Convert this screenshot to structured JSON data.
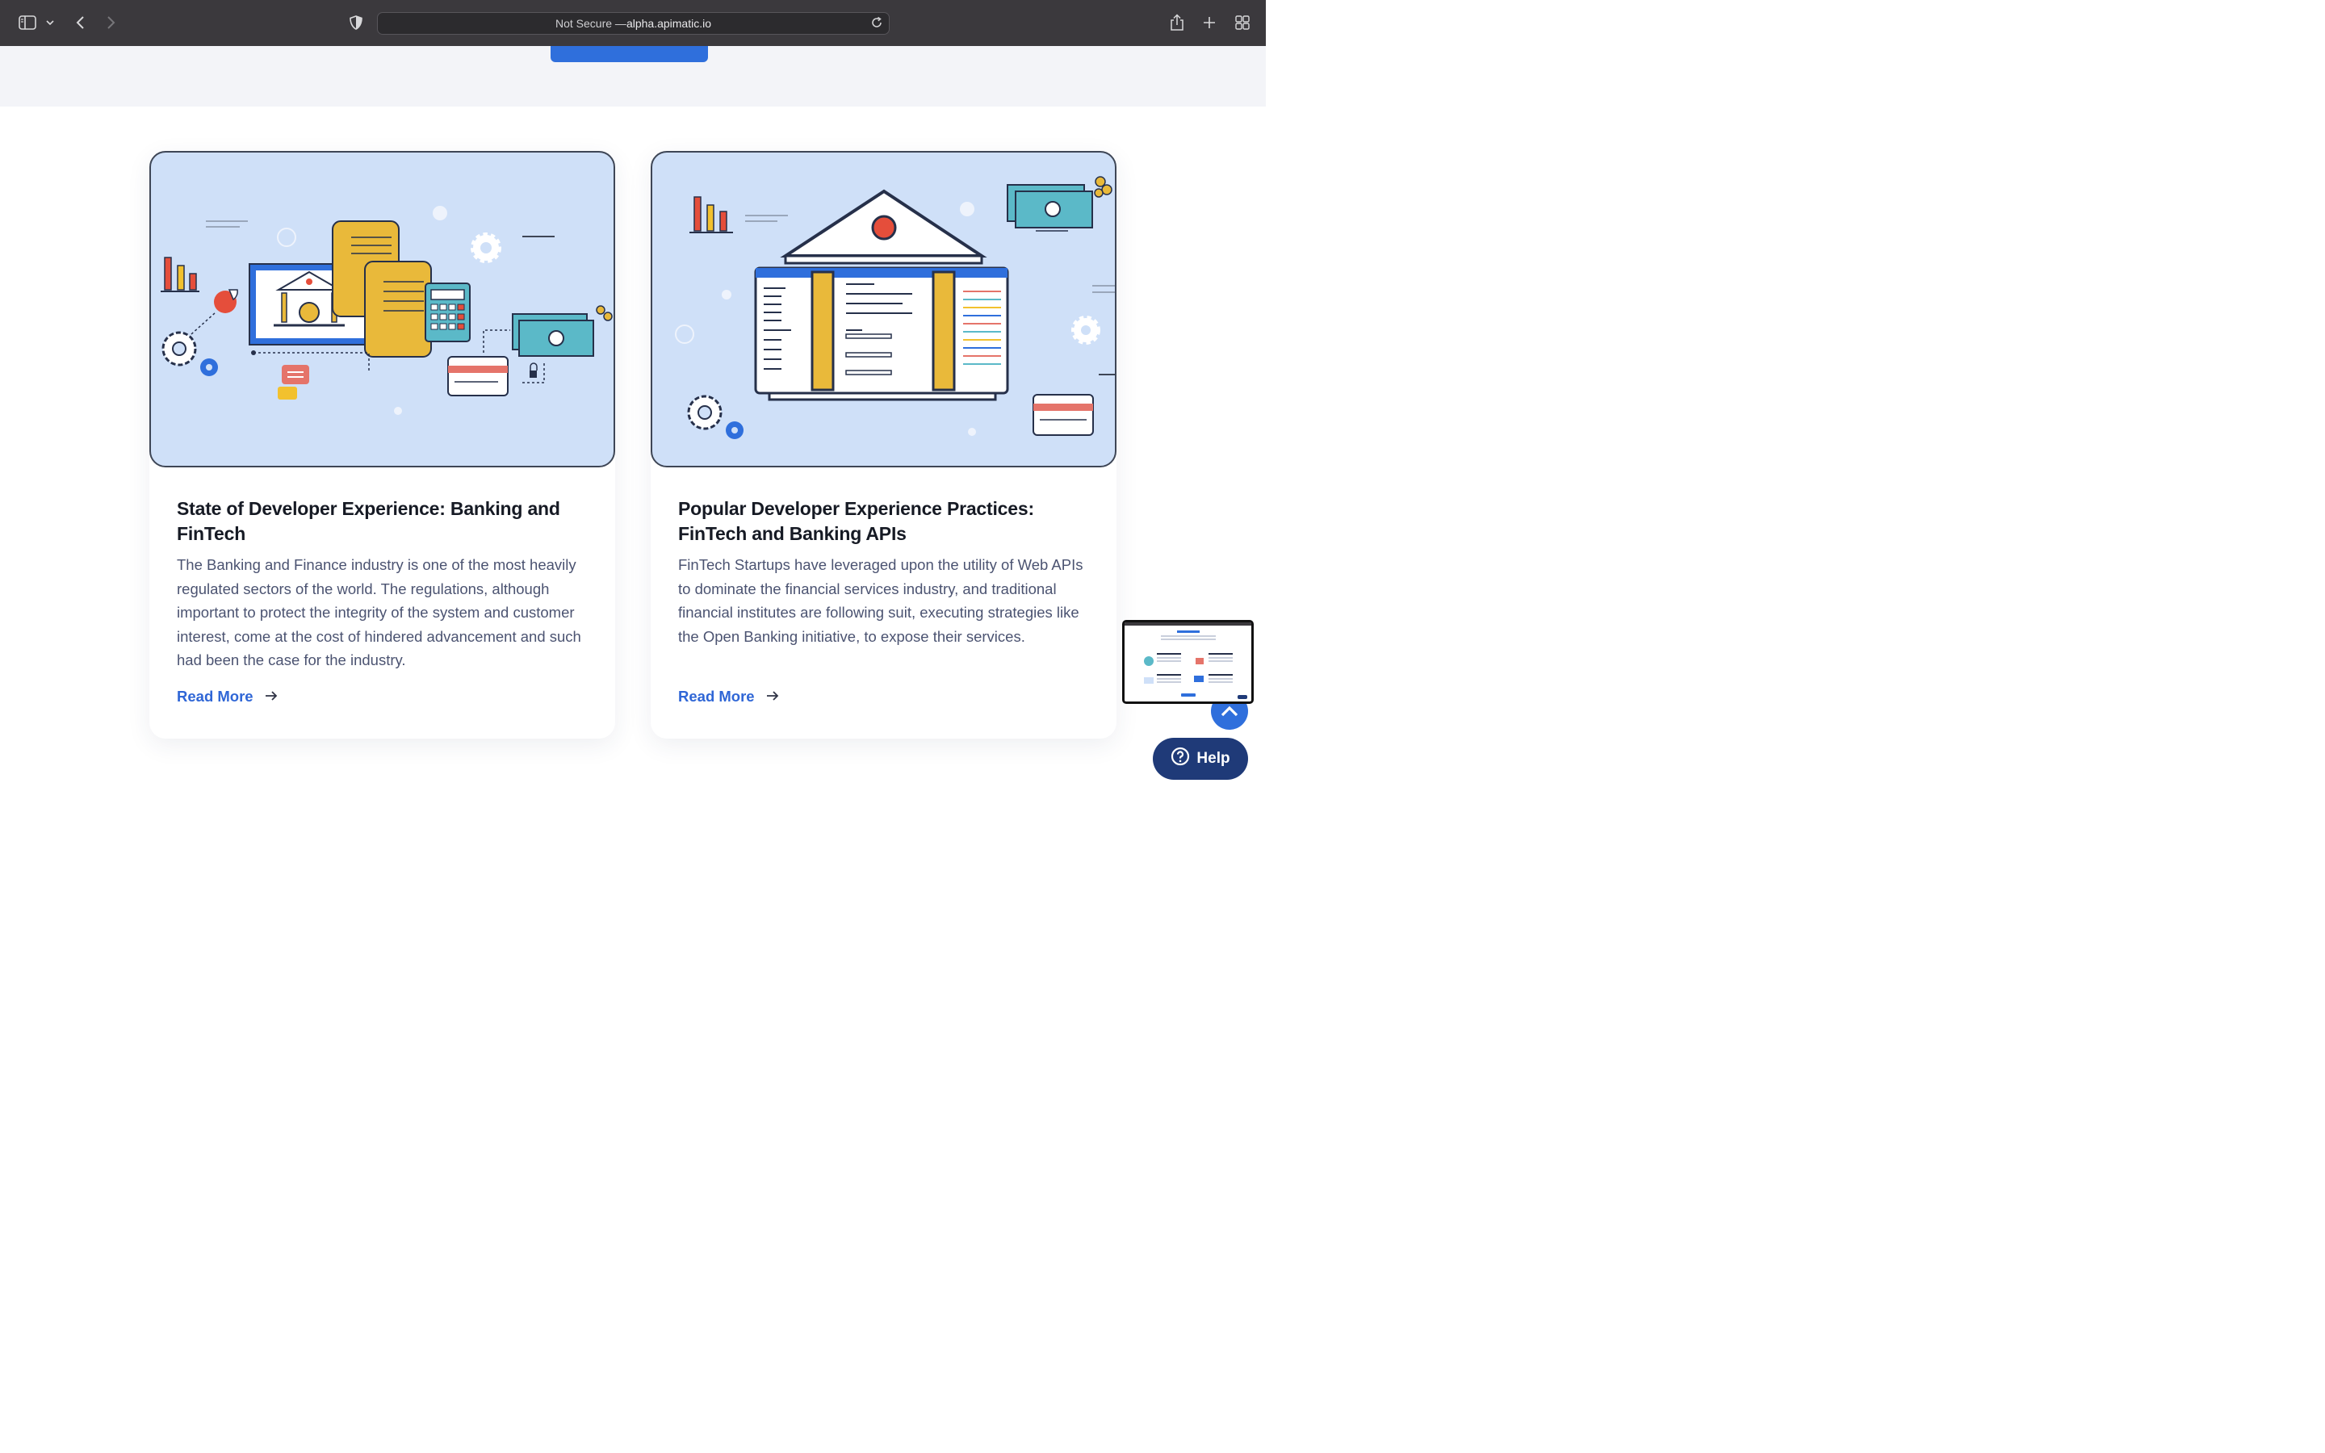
{
  "browser": {
    "url_prefix": "Not Secure — ",
    "url_host": "alpha.apimatic.io",
    "icons": [
      "sidebar-icon",
      "chevron-down-icon",
      "back-icon",
      "forward-icon",
      "shield-icon",
      "reload-icon",
      "share-icon",
      "new-tab-icon",
      "tab-overview-icon"
    ]
  },
  "cards": [
    {
      "title": "State of Developer Experience: Banking and FinTech",
      "body": "The Banking and Finance industry is one of the most heavily regulated sectors of the world. The regulations, although important to protect the integrity of the system and customer interest, come at the cost of hindered advancement and such had been the case for the industry.",
      "link": "Read More"
    },
    {
      "title": "Popular Developer Experience Practices: FinTech and Banking APIs",
      "body": "FinTech Startups have leveraged upon the utility of Web APIs to dominate the financial services industry, and traditional financial institutes are following suit, executing strategies like the Open Banking initiative, to expose their services.",
      "link": "Read More"
    }
  ],
  "help": {
    "label": "Help"
  },
  "colors": {
    "chrome": "#3b393d",
    "accent": "#2f6fdc",
    "link": "#2f66d6",
    "help_bg": "#1f3a78",
    "art_bg": "#cfe0f8",
    "title": "#161a24",
    "body": "#4b5371"
  }
}
